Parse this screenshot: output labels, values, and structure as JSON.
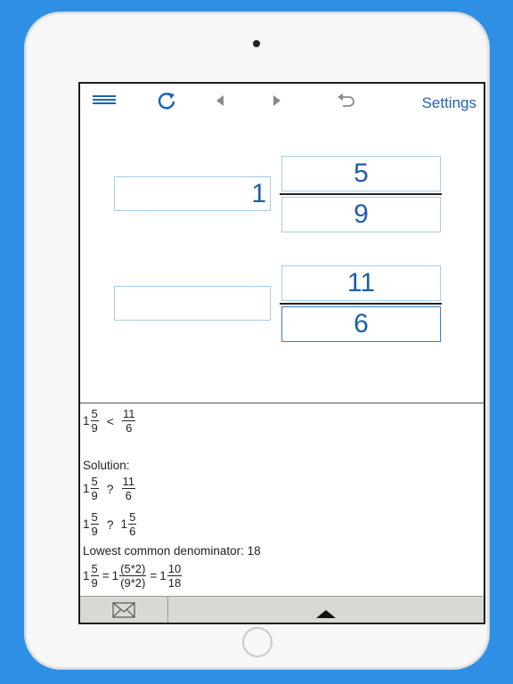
{
  "toolbar": {
    "menu_icon": "menu-icon",
    "refresh_icon": "refresh-icon",
    "prev_icon": "triangle-left-icon",
    "next_icon": "triangle-right-icon",
    "undo_icon": "undo-icon",
    "settings_label": "Settings"
  },
  "fraction1": {
    "whole": "1",
    "numerator": "5",
    "denominator": "9"
  },
  "fraction2": {
    "whole": "",
    "numerator": "11",
    "denominator": "6"
  },
  "log": {
    "comparison": {
      "whole1": "1",
      "num1": "5",
      "den1": "9",
      "symbol": "<",
      "num2": "11",
      "den2": "6"
    },
    "solution_label": "Solution:",
    "step1": {
      "whole1": "1",
      "num1": "5",
      "den1": "9",
      "symbol": "?",
      "num2": "11",
      "den2": "6"
    },
    "step2": {
      "whole1": "1",
      "num1": "5",
      "den1": "9",
      "symbol": "?",
      "whole2": "1",
      "num2": "5",
      "den2": "6"
    },
    "lcd_text": "Lowest common denominator: 18",
    "step3": {
      "whole1": "1",
      "num1": "5",
      "den1": "9",
      "eq": "=",
      "whole2": "1",
      "num2": "(5*2)",
      "den2": "(9*2)",
      "eq2": "=",
      "whole3": "1",
      "num3": "10",
      "den3": "18"
    }
  },
  "bottom_bar": {
    "mail_icon": "envelope-icon",
    "expand_icon": "triangle-up-icon"
  },
  "colors": {
    "background": "#2e8fe4",
    "accent": "#1c64b0",
    "input_border": "#a7cdea"
  }
}
